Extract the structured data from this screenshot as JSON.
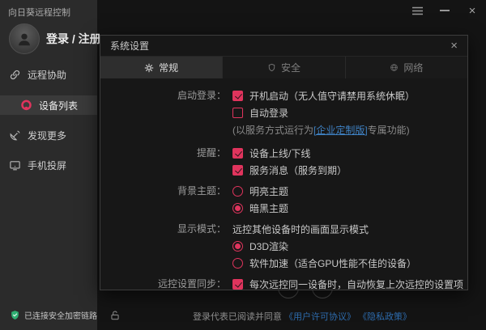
{
  "colors": {
    "accent": "#e0345d",
    "link": "#3f82c4",
    "link-dim": "#2e6cae",
    "green": "#2fae72"
  },
  "window": {
    "title": "向日葵远程控制"
  },
  "sidebar": {
    "login": "登录 / 注册",
    "items": [
      {
        "label": "远程协助",
        "icon": "link-icon",
        "active": false
      },
      {
        "label": "设备列表",
        "icon": "sunlogin-icon",
        "active": true
      },
      {
        "label": "发现更多",
        "icon": "radar-icon",
        "active": false
      },
      {
        "label": "手机投屏",
        "icon": "screen-cast-icon",
        "active": false
      }
    ],
    "secure_status": "已连接安全加密链路"
  },
  "dialog": {
    "title": "系统设置",
    "tabs": [
      {
        "label": "常规",
        "icon": "gear-icon",
        "active": true
      },
      {
        "label": "安全",
        "icon": "shield-icon",
        "active": false
      },
      {
        "label": "网络",
        "icon": "globe-icon",
        "active": false
      }
    ],
    "sections": [
      {
        "label": "启动登录：",
        "rows": [
          {
            "type": "checkbox",
            "checked": true,
            "text": "开机启动（无人值守请禁用系统休眠）"
          },
          {
            "type": "checkbox",
            "checked": false,
            "text": "自动登录"
          },
          {
            "type": "note",
            "prefix": "(以服务方式运行为",
            "link": "[企业定制版]",
            "suffix": "专属功能)"
          }
        ]
      },
      {
        "label": "提醒：",
        "rows": [
          {
            "type": "checkbox",
            "checked": true,
            "text": "设备上线/下线"
          },
          {
            "type": "checkbox",
            "checked": true,
            "text": "服务消息（服务到期）"
          }
        ]
      },
      {
        "label": "背景主题：",
        "rows": [
          {
            "type": "radio",
            "checked": false,
            "text": "明亮主题"
          },
          {
            "type": "radio",
            "checked": true,
            "text": "暗黑主题"
          }
        ]
      },
      {
        "label": "显示模式：",
        "rows": [
          {
            "type": "text",
            "text": "远控其他设备时的画面显示模式"
          },
          {
            "type": "radio",
            "checked": true,
            "text": "D3D渲染"
          },
          {
            "type": "radio",
            "checked": false,
            "text": "软件加速（适合GPU性能不佳的设备）"
          }
        ]
      },
      {
        "label": "远控设置同步：",
        "rows": [
          {
            "type": "checkbox",
            "checked": true,
            "text": "每次远控同一设备时，自动恢复上次远控的设置项"
          }
        ]
      }
    ]
  },
  "footer": {
    "agreement_prefix": "登录代表已阅读并同意",
    "license_link": "《用户许可协议》",
    "privacy_link": "《隐私政策》"
  }
}
